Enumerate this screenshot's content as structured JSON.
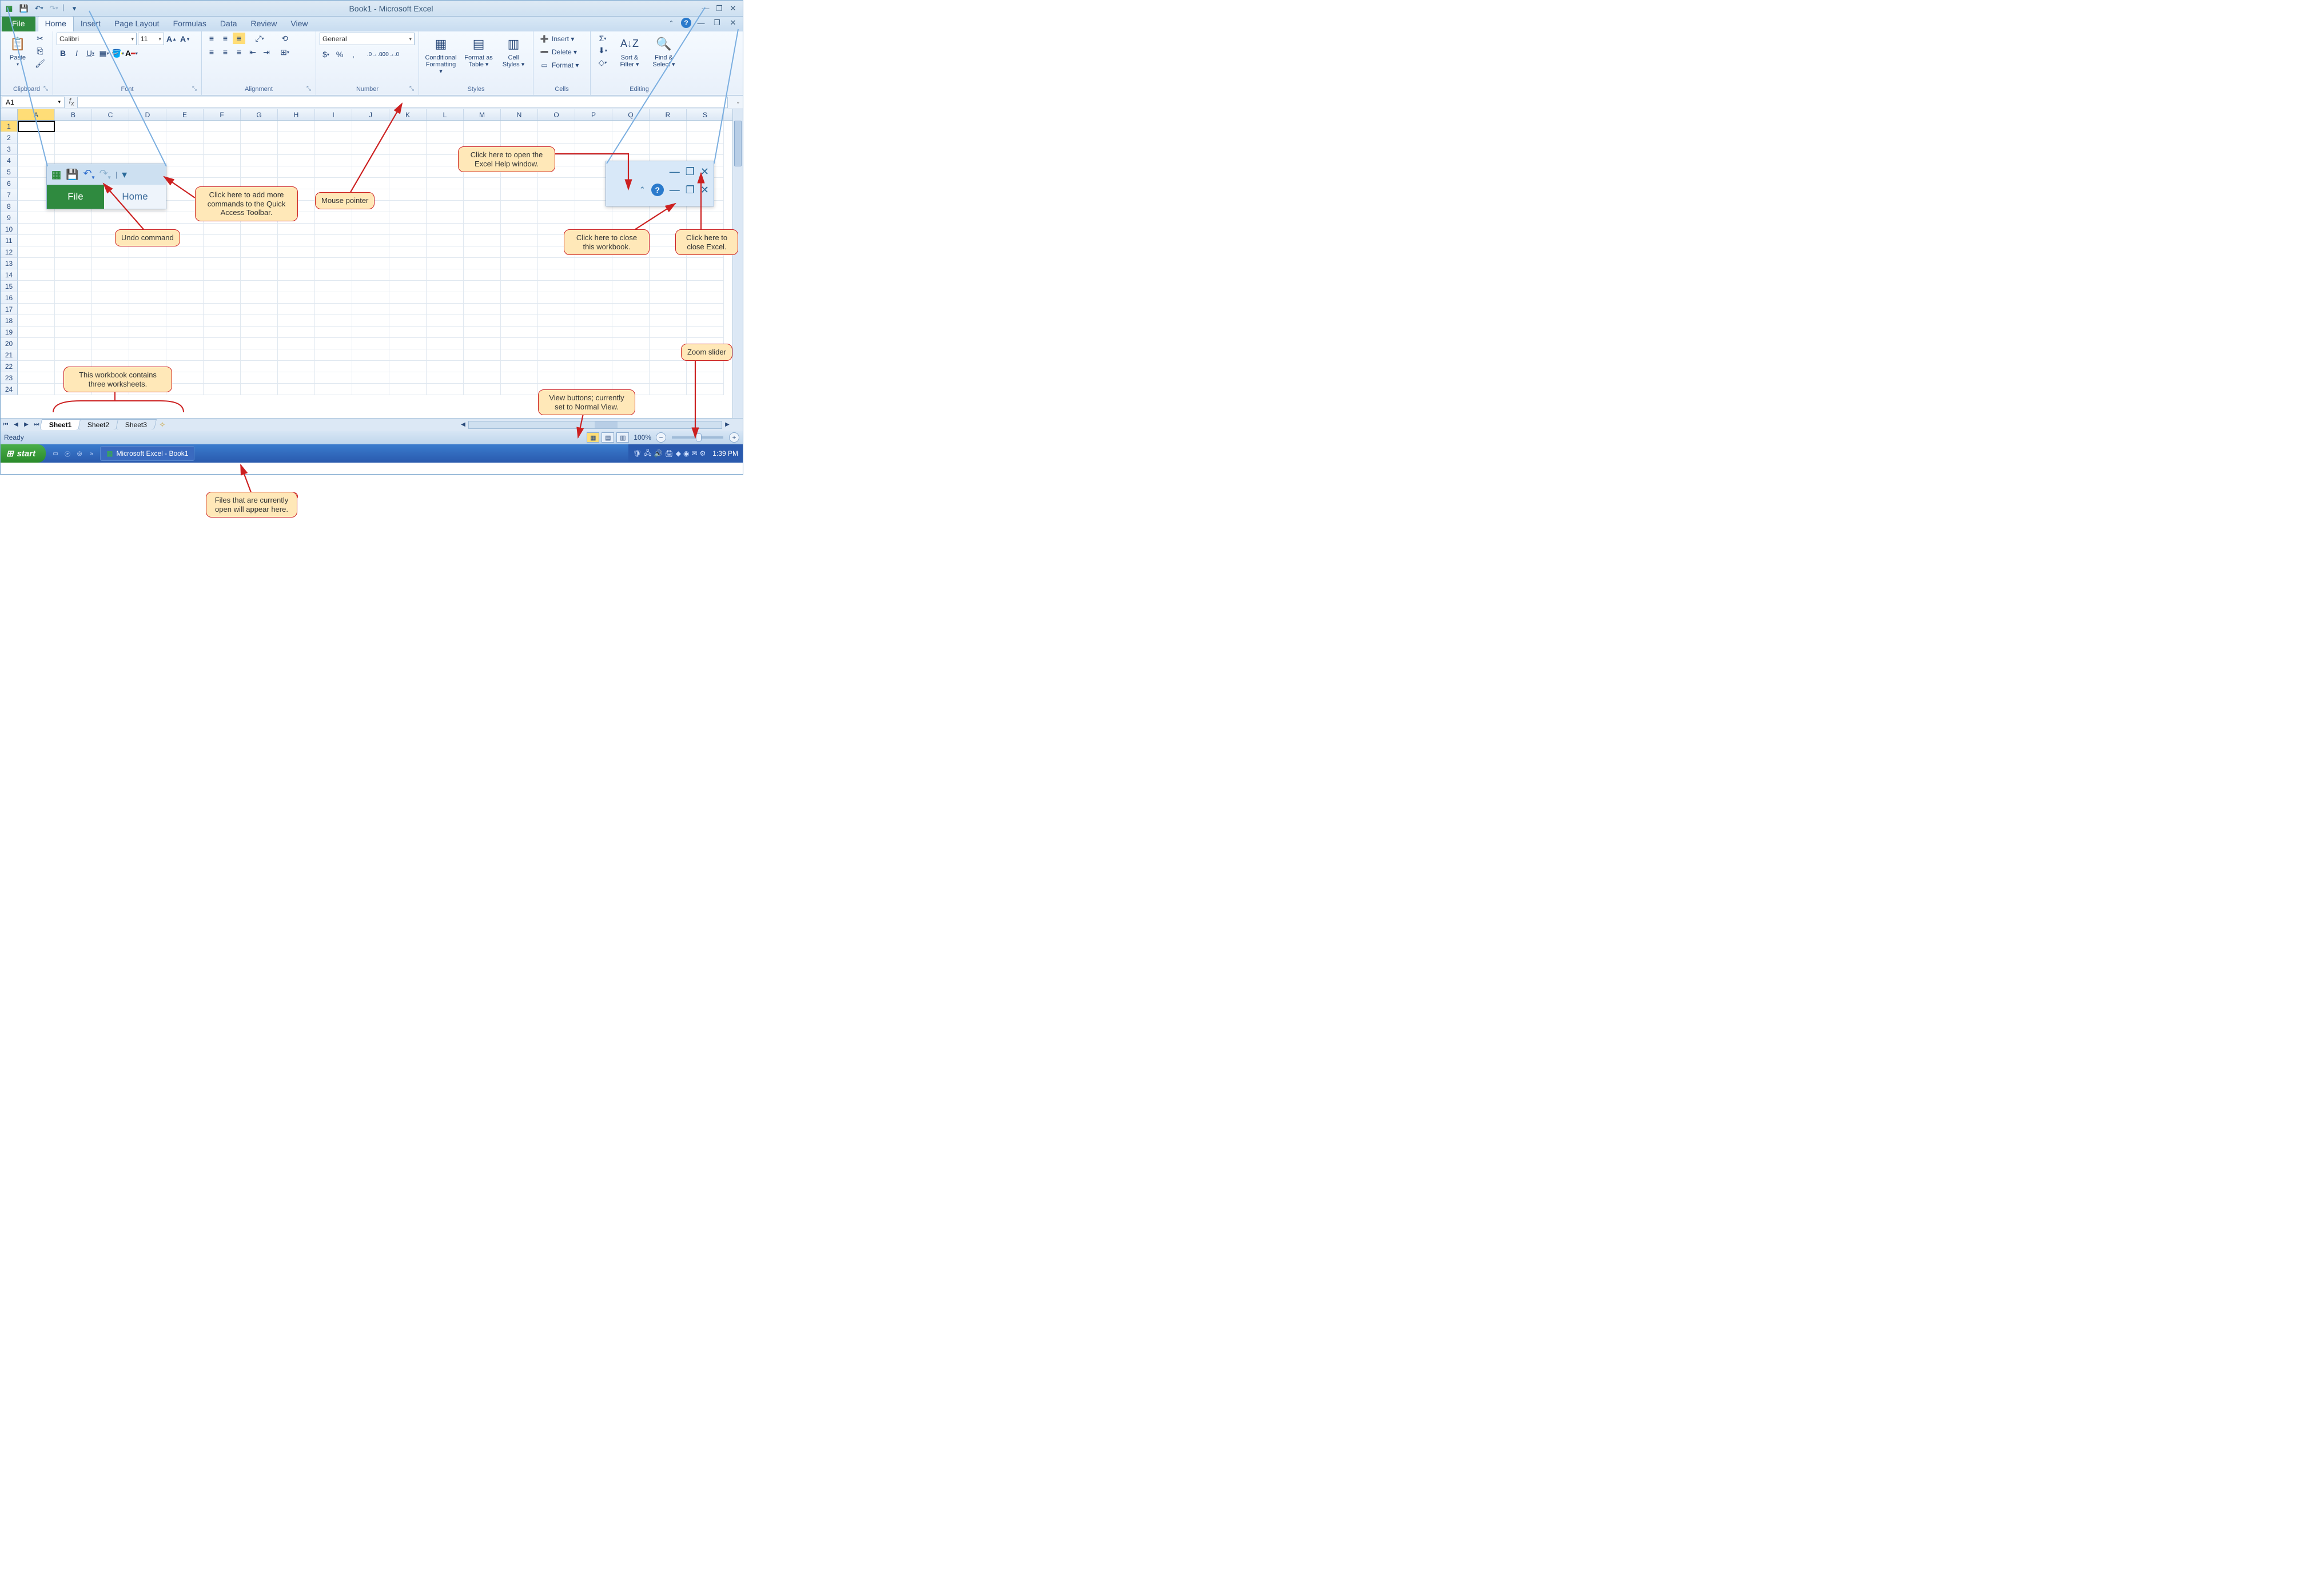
{
  "title": "Book1 - Microsoft Excel",
  "qat": {
    "save": "💾",
    "undo": "↶",
    "redo": "↷",
    "customize": "▾"
  },
  "tabs": {
    "file": "File",
    "home": "Home",
    "insert": "Insert",
    "pagelayout": "Page Layout",
    "formulas": "Formulas",
    "data": "Data",
    "review": "Review",
    "view": "View"
  },
  "ribbon": {
    "clipboard": {
      "label": "Clipboard",
      "paste": "Paste"
    },
    "font": {
      "label": "Font",
      "name": "Calibri",
      "size": "11"
    },
    "alignment": {
      "label": "Alignment"
    },
    "number": {
      "label": "Number",
      "format": "General"
    },
    "styles": {
      "label": "Styles",
      "cond": "Conditional Formatting ▾",
      "table": "Format as Table ▾",
      "cell": "Cell Styles ▾"
    },
    "cells": {
      "label": "Cells",
      "insert": "Insert ▾",
      "delete": "Delete ▾",
      "format": "Format ▾"
    },
    "editing": {
      "label": "Editing",
      "sort": "Sort & Filter ▾",
      "find": "Find & Select ▾"
    }
  },
  "namebox": "A1",
  "columns": [
    "A",
    "B",
    "C",
    "D",
    "E",
    "F",
    "G",
    "H",
    "I",
    "J",
    "K",
    "L",
    "M",
    "N",
    "O",
    "P",
    "Q",
    "R",
    "S"
  ],
  "rows": [
    "1",
    "2",
    "3",
    "4",
    "5",
    "6",
    "7",
    "8",
    "9",
    "10",
    "11",
    "12",
    "13",
    "14",
    "15",
    "16",
    "17",
    "18",
    "19",
    "20",
    "21",
    "22",
    "23",
    "24"
  ],
  "sheets": {
    "s1": "Sheet1",
    "s2": "Sheet2",
    "s3": "Sheet3"
  },
  "status": {
    "ready": "Ready",
    "zoom": "100%"
  },
  "taskbar": {
    "start": "start",
    "app": "Microsoft Excel - Book1",
    "clock": "1:39 PM"
  },
  "callouts": {
    "qat": "Click here to add more commands to the Quick Access Toolbar.",
    "undo": "Undo command",
    "mouse": "Mouse pointer",
    "help": "Click here to open the Excel Help window.",
    "closewb": "Click here to close this workbook.",
    "closexl": "Click here to close Excel.",
    "sheets": "This workbook contains three worksheets.",
    "views": "View buttons; currently set to Normal View.",
    "zoom": "Zoom slider",
    "files": "Files that are currently open will appear here."
  },
  "zfile": "File",
  "zhome": "Home"
}
